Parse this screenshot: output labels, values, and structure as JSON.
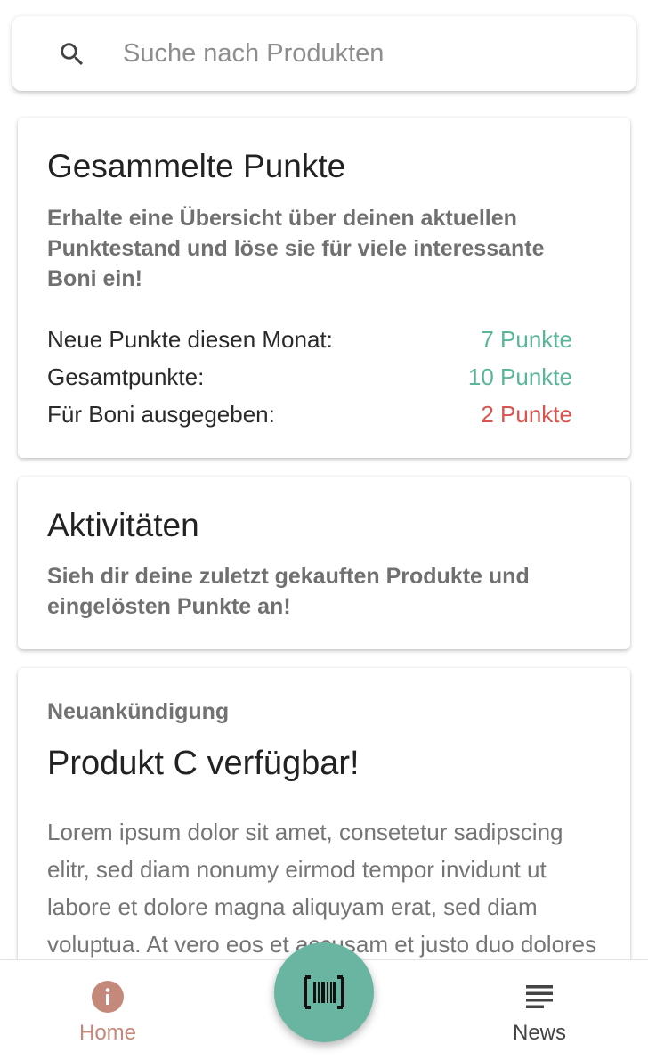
{
  "search": {
    "placeholder": "Suche nach Produkten",
    "icon": "search-icon"
  },
  "points_card": {
    "title": "Gesammelte Punkte",
    "subtitle": "Erhalte eine Übersicht über deinen aktuellen Punktestand und löse sie für viele interessante Boni ein!",
    "rows": [
      {
        "label": "Neue Punkte diesen Monat:",
        "value": "7 Punkte",
        "color": "#5bb59a"
      },
      {
        "label": "Gesamtpunkte:",
        "value": "10 Punkte",
        "color": "#5bb59a"
      },
      {
        "label": "Für Boni ausgegeben:",
        "value": "2 Punkte",
        "color": "#d9534f"
      }
    ]
  },
  "activities_card": {
    "title": "Aktivitäten",
    "subtitle": "Sieh dir deine zuletzt gekauften Produkte und eingelösten Punkte an!"
  },
  "news_card": {
    "overline": "Neuankündigung",
    "title": "Produkt C verfügbar!",
    "body": "Lorem ipsum dolor sit amet, consetetur sadipscing elitr, sed diam nonumy eirmod tempor invidunt ut labore et dolore magna aliquyam erat, sed diam voluptua. At vero eos et accusam et justo duo dolores et ea rebum."
  },
  "bottom_nav": {
    "items": [
      {
        "label": "Home",
        "icon": "info-icon",
        "active": true
      },
      {
        "label": "News",
        "icon": "news-icon",
        "active": false
      }
    ],
    "fab_icon": "barcode-scanner-icon"
  },
  "colors": {
    "accent": "#6ab5a1",
    "active_nav": "#c4897a",
    "inactive_nav": "#444444",
    "positive": "#5bb59a",
    "negative": "#d9534f"
  }
}
